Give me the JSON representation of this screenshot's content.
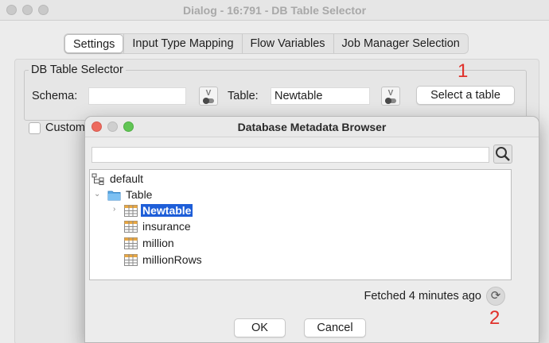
{
  "window": {
    "title": "Dialog - 16:791 - DB Table Selector"
  },
  "tabs": [
    "Settings",
    "Input Type Mapping",
    "Flow Variables",
    "Job Manager Selection"
  ],
  "group": {
    "legend": "DB Table Selector",
    "schema_label": "Schema:",
    "schema_value": "",
    "table_label": "Table:",
    "table_value": "Newtable",
    "select_button": "Select a table"
  },
  "custom_checkbox_label": "Custom",
  "annotations": {
    "first": "1",
    "second": "2"
  },
  "browser": {
    "title": "Database Metadata Browser",
    "search_value": "",
    "tree": {
      "root": "default",
      "folder": "Table",
      "items": [
        "Newtable",
        "insurance",
        "million",
        "millionRows"
      ],
      "selected_index": 0
    },
    "fetched": "Fetched 4 minutes ago",
    "ok": "OK",
    "cancel": "Cancel"
  },
  "colors": {
    "selection": "#1e5ed8",
    "annotation": "#e0302a",
    "close": "#ed6a5e",
    "minimize": "#f5bf4f",
    "zoom": "#61c554"
  },
  "icons": [
    "search-icon",
    "refresh-icon",
    "folder-icon",
    "table-icon",
    "schema-icon",
    "flow-variable-icon"
  ]
}
